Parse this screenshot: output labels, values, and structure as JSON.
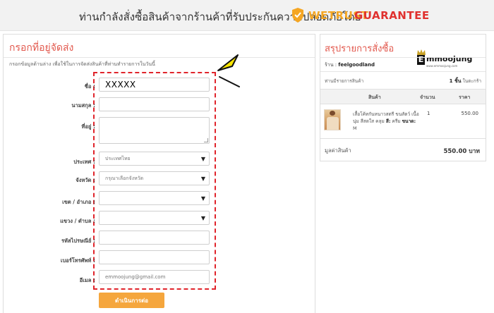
{
  "banner": {
    "text": "ท่านกำลังสั่งซื้อสินค้าจากร้านค้าที่รับประกันความปลอดภัยโดย",
    "brand_part1": "WETRUST",
    "brand_part2": "GUARANTEE",
    "icon": "shield-check-icon",
    "brand_color_1": "#f5a623",
    "brand_color_2": "#e0312f"
  },
  "form": {
    "title": "กรอกที่อยู่จัดส่ง",
    "description": "กรอกข้อมูลด้านล่าง เพื่อใช้ในการจัดส่งสินค้าที่ท่านทำรายการในวันนี้",
    "fields": {
      "name": {
        "label": "ชื่อ :",
        "value": "XXXXX"
      },
      "surname": {
        "label": "นามสกุล :",
        "value": ""
      },
      "address": {
        "label": "ที่อยู่ :",
        "value": ""
      },
      "country": {
        "label": "ประเทศ :",
        "value": "ประเทศไทย"
      },
      "province": {
        "label": "จังหวัด :",
        "value": "กรุณาเลือกจังหวัด"
      },
      "district": {
        "label": "เขต / อำเภอ :",
        "value": ""
      },
      "subdistrict": {
        "label": "แขวง / ตำบล :",
        "value": ""
      },
      "postcode": {
        "label": "รหัสไปรษณีย์ :",
        "value": ""
      },
      "phone": {
        "label": "เบอร์โทรศัพท์ :",
        "value": ""
      },
      "email": {
        "label": "อีเมล :",
        "value": "emmoojung@gmail.com"
      }
    },
    "submit_label": "ดำเนินการต่อ",
    "accent_color": "#e2584d",
    "highlight_color": "#e0242b",
    "button_color": "#f5a63d",
    "pointer_color": "#f7e400"
  },
  "summary": {
    "title": "สรุปรายการสั่งซื้อ",
    "shop_prefix": "ร้าน :",
    "shop_name": "feelgoodland",
    "logo_text": "mmoojung",
    "logo_letter": "E",
    "logo_sub": "www.emmoojung.com",
    "cart_label": "ท่านมีรายการสินค้า",
    "cart_count": "1 ชิ้น",
    "cart_suffix": "ในตะกร้า",
    "columns": {
      "product": "สินค้า",
      "qty": "จำนวน",
      "price": "ราคา"
    },
    "item": {
      "desc": "เสื้อโค้ทกันหนาวสตรี ขนสัตว์ เนื้อนุ่ม สีสดใส คลุม",
      "color_label": "สี:",
      "color_value": "ครีม",
      "size_label": "ขนาด:",
      "size_value": "M",
      "qty": "1",
      "price": "550.00"
    },
    "total_label": "มูลค่าสินค้า",
    "total_value": "550.00 บาท"
  }
}
